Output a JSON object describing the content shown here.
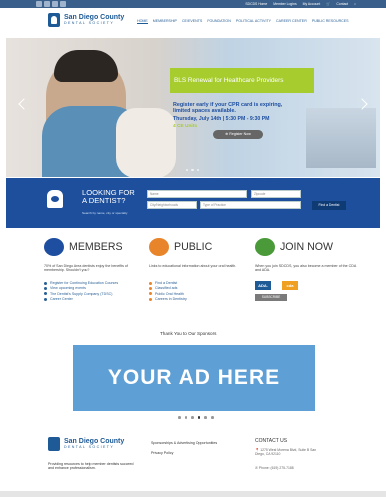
{
  "topbar": {
    "links": [
      "SDCDS Home",
      "Member Logins",
      "My Account",
      "Contact"
    ]
  },
  "header": {
    "logo_line1": "San Diego County",
    "logo_line2": "DENTAL SOCIETY",
    "nav": [
      "HOME",
      "MEMBERSHIP",
      "CE/EVENTS",
      "FOUNDATION",
      "POLITICAL ACTIVITY",
      "CAREER CENTER",
      "PUBLIC RESOURCES"
    ]
  },
  "hero": {
    "banner": "BLS Renewal for Healthcare Providers",
    "promo_line1": "Register early if your CPR card is expiring,",
    "promo_line2": "limited spaces available.",
    "promo_date": "Thursday, July 14th | 5:30 PM - 9:30 PM",
    "promo_ce": "4 CE Units",
    "register_label": "Register Now"
  },
  "dentist": {
    "heading_line1": "LOOKING FOR",
    "heading_line2": "A DENTIST?",
    "hint": "Search by name, city or specialty",
    "fields": [
      "Name",
      "Zipcode",
      "City/Neighborhoods",
      "Type of Practice"
    ],
    "find_label": "Find a Dentist"
  },
  "members": {
    "title": "MEMBERS",
    "text": "70% of San Diego Area dentists enjoy the benefits of membership. Shouldn't you?",
    "items": [
      "Register for Continuing Education Courses",
      "View upcoming events",
      "The Dentist's Supply Company (TDSC)",
      "Career Center"
    ]
  },
  "public": {
    "title": "PUBLIC",
    "text": "Links to educational information about your oral health.",
    "items": [
      "Find a Dentist",
      "Classified ads",
      "Public Oral Health",
      "Careers in Dentistry"
    ]
  },
  "join": {
    "title": "JOIN NOW",
    "text": "When you join SDCDS, you also become a member of the CDA and ADA.",
    "badge1": "ADA.",
    "badge2": "cda",
    "subscribe_label": "SUBSCRIBE"
  },
  "sponsors": {
    "title": "Thank You to Our Sponsors",
    "ad_text": "YOUR AD HERE"
  },
  "footer": {
    "logo_line1": "San Diego County",
    "logo_line2": "DENTAL SOCIETY",
    "tagline": "Providing resources to help member dentists succeed and enhance professionalism.",
    "links": [
      "Sponsorships & Advertising Opportunities",
      "Privacy Policy"
    ],
    "contact_title": "CONTACT US",
    "address": "1275 West Morena Blvd, Suite B San Diego, CA 92110",
    "phone": "Phone: (619) 275-7188"
  },
  "colors": {
    "brand_blue": "#1d4f9c",
    "accent_green": "#a6cc2e",
    "ad_blue": "#5e9fd6"
  }
}
